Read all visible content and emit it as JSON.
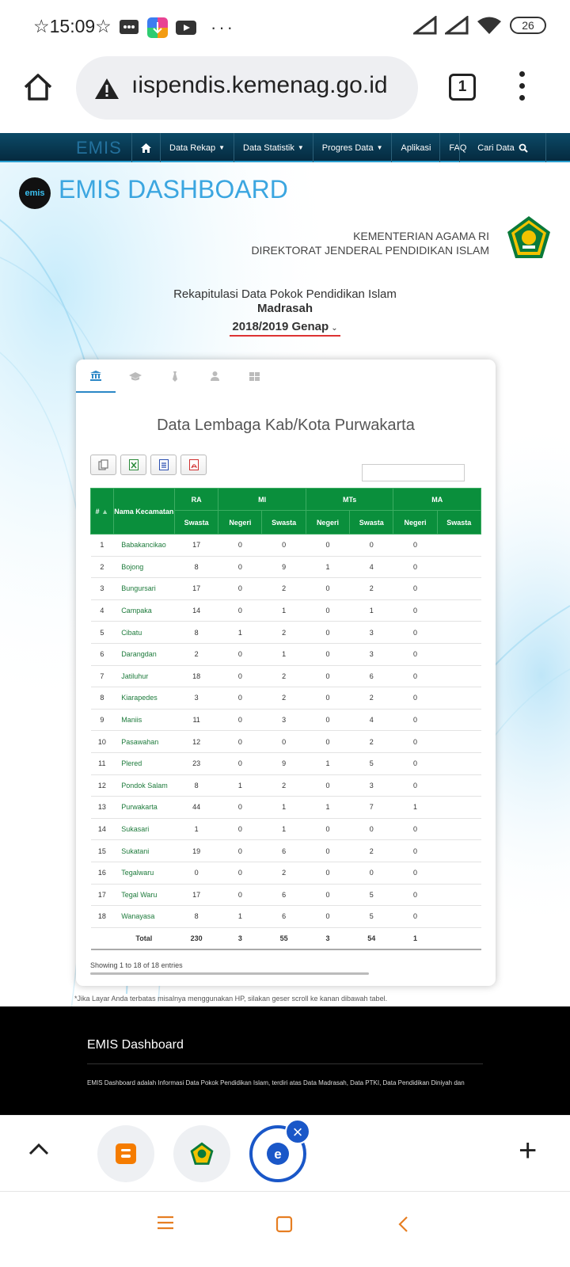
{
  "status_bar": {
    "time": "☆15:09☆",
    "more": "···",
    "battery": "26"
  },
  "browser": {
    "url": "ıispendis.kemenag.go.id",
    "tab_count": "1"
  },
  "nav": {
    "logo": "EMIS",
    "items": [
      {
        "label": "Data Rekap",
        "caret": true
      },
      {
        "label": "Data Statistik",
        "caret": true
      },
      {
        "label": "Progres Data",
        "caret": true
      },
      {
        "label": "Aplikasi",
        "caret": false
      },
      {
        "label": "FAQ",
        "caret": false
      }
    ],
    "search_label": "Cari Data"
  },
  "header": {
    "logo_text": "emis",
    "title": "EMIS DASHBOARD",
    "ministry_line1": "KEMENTERIAN AGAMA RI",
    "ministry_line2": "DIREKTORAT JENDERAL PENDIDIKAN ISLAM"
  },
  "rekap": {
    "line1": "Rekapitulasi Data Pokok Pendidikan Islam",
    "line2": "Madrasah",
    "period": "2018/2019 Genap"
  },
  "card": {
    "title": "Data Lembaga Kab/Kota Purwakarta",
    "export_buttons": [
      "copy-icon",
      "excel-icon",
      "csv-icon",
      "pdf-icon"
    ],
    "search_value": "",
    "info": "Showing 1 to 18 of 18 entries"
  },
  "table": {
    "header_no": "#",
    "header_name": "Nama Kecamatan",
    "groups": [
      {
        "label": "RA",
        "subs": [
          "Swasta"
        ]
      },
      {
        "label": "MI",
        "subs": [
          "Negeri",
          "Swasta"
        ]
      },
      {
        "label": "MTs",
        "subs": [
          "Negeri",
          "Swasta"
        ]
      },
      {
        "label": "MA",
        "subs": [
          "Negeri",
          "Swasta"
        ]
      }
    ],
    "rows": [
      {
        "no": "1",
        "name": "Babakancikao",
        "vals": [
          "17",
          "0",
          "0",
          "0",
          "0",
          "0"
        ]
      },
      {
        "no": "2",
        "name": "Bojong",
        "vals": [
          "8",
          "0",
          "9",
          "1",
          "4",
          "0"
        ]
      },
      {
        "no": "3",
        "name": "Bungursari",
        "vals": [
          "17",
          "0",
          "2",
          "0",
          "2",
          "0"
        ]
      },
      {
        "no": "4",
        "name": "Campaka",
        "vals": [
          "14",
          "0",
          "1",
          "0",
          "1",
          "0"
        ]
      },
      {
        "no": "5",
        "name": "Cibatu",
        "vals": [
          "8",
          "1",
          "2",
          "0",
          "3",
          "0"
        ]
      },
      {
        "no": "6",
        "name": "Darangdan",
        "vals": [
          "2",
          "0",
          "1",
          "0",
          "3",
          "0"
        ]
      },
      {
        "no": "7",
        "name": "Jatiluhur",
        "vals": [
          "18",
          "0",
          "2",
          "0",
          "6",
          "0"
        ]
      },
      {
        "no": "8",
        "name": "Kiarapedes",
        "vals": [
          "3",
          "0",
          "2",
          "0",
          "2",
          "0"
        ]
      },
      {
        "no": "9",
        "name": "Maniis",
        "vals": [
          "11",
          "0",
          "3",
          "0",
          "4",
          "0"
        ]
      },
      {
        "no": "10",
        "name": "Pasawahan",
        "vals": [
          "12",
          "0",
          "0",
          "0",
          "2",
          "0"
        ]
      },
      {
        "no": "11",
        "name": "Plered",
        "vals": [
          "23",
          "0",
          "9",
          "1",
          "5",
          "0"
        ]
      },
      {
        "no": "12",
        "name": "Pondok Salam",
        "vals": [
          "8",
          "1",
          "2",
          "0",
          "3",
          "0"
        ]
      },
      {
        "no": "13",
        "name": "Purwakarta",
        "vals": [
          "44",
          "0",
          "1",
          "1",
          "7",
          "1"
        ]
      },
      {
        "no": "14",
        "name": "Sukasari",
        "vals": [
          "1",
          "0",
          "1",
          "0",
          "0",
          "0"
        ]
      },
      {
        "no": "15",
        "name": "Sukatani",
        "vals": [
          "19",
          "0",
          "6",
          "0",
          "2",
          "0"
        ]
      },
      {
        "no": "16",
        "name": "Tegalwaru",
        "vals": [
          "0",
          "0",
          "2",
          "0",
          "0",
          "0"
        ]
      },
      {
        "no": "17",
        "name": "Tegal Waru",
        "vals": [
          "17",
          "0",
          "6",
          "0",
          "5",
          "0"
        ]
      },
      {
        "no": "18",
        "name": "Wanayasa",
        "vals": [
          "8",
          "1",
          "6",
          "0",
          "5",
          "0"
        ]
      }
    ],
    "total_label": "Total",
    "totals": [
      "230",
      "3",
      "55",
      "3",
      "54",
      "1"
    ]
  },
  "note": "*Jika Layar Anda terbatas misalnya menggunakan HP, silakan geser scroll ke kanan dibawah tabel.",
  "footer": {
    "title": "EMIS Dashboard",
    "text": "EMIS Dashboard adalah Informasi Data Pokok Pendidikan Islam, terdiri atas Data Madrasah, Data PTKI, Data Pendidikan Diniyah dan"
  },
  "colors": {
    "table_header": "#0a8f3c",
    "accent_blue": "#1a57c8",
    "title_blue": "#3ba6e0",
    "nav_orange": "#e67e22"
  }
}
